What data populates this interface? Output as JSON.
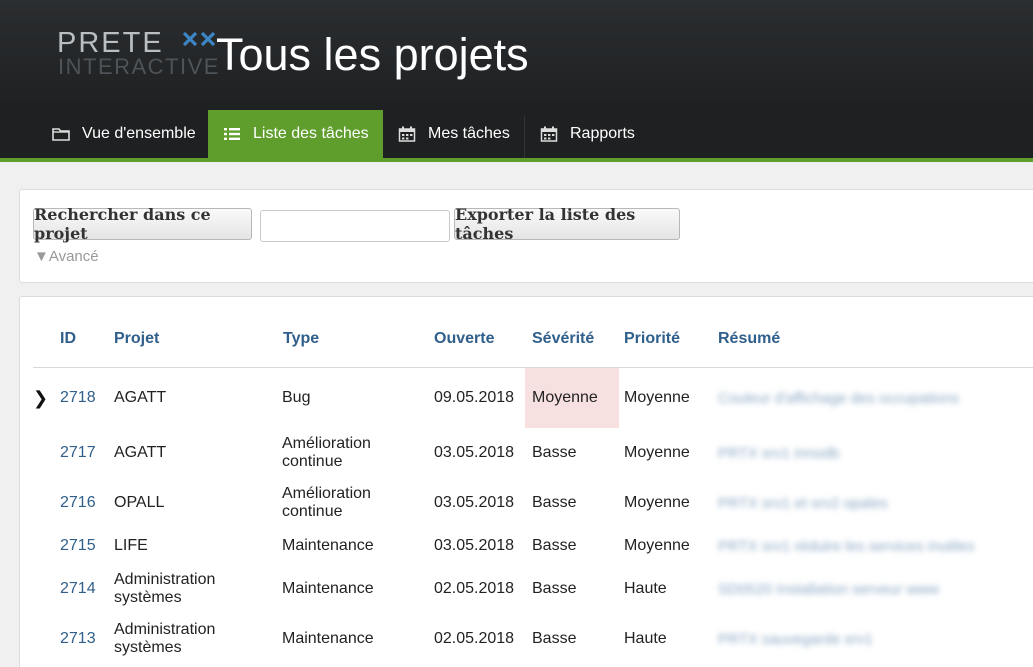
{
  "header": {
    "logo_line1": "PRETE",
    "logo_line2": "INTERACTIVE",
    "logo_mark": "xx",
    "title": "Tous les projets"
  },
  "nav": {
    "tabs": [
      {
        "label": "Vue d'ensemble",
        "icon": "folder-icon",
        "active": false
      },
      {
        "label": "Liste des tâches",
        "icon": "list-icon",
        "active": true
      },
      {
        "label": "Mes tâches",
        "icon": "calendar-icon",
        "active": false
      },
      {
        "label": "Rapports",
        "icon": "calendar-icon",
        "active": false
      }
    ],
    "active_color": "#5f9e2d"
  },
  "search": {
    "button_label": "Rechercher dans ce projet",
    "input_value": "",
    "export_label": "Exporter la liste des tâches",
    "advanced_label": "▼Avancé"
  },
  "table": {
    "columns": [
      "ID",
      "Projet",
      "Type",
      "Ouverte",
      "Sévérité",
      "Priorité",
      "Résumé"
    ],
    "rows": [
      {
        "id": "2718",
        "projet": "AGATT",
        "type": "Bug",
        "ouverte": "09.05.2018",
        "severite": "Moyenne",
        "priorite": "Moyenne",
        "resume": "Couleur d'affichage des occupations",
        "selected": true
      },
      {
        "id": "2717",
        "projet": "AGATT",
        "type": "Amélioration continue",
        "ouverte": "03.05.2018",
        "severite": "Basse",
        "priorite": "Moyenne",
        "resume": "PRTX srv1 innodb"
      },
      {
        "id": "2716",
        "projet": "OPALL",
        "type": "Amélioration continue",
        "ouverte": "03.05.2018",
        "severite": "Basse",
        "priorite": "Moyenne",
        "resume": "PRTX srv1 et srv2 opales"
      },
      {
        "id": "2715",
        "projet": "LIFE",
        "type": "Maintenance",
        "ouverte": "03.05.2018",
        "severite": "Basse",
        "priorite": "Moyenne",
        "resume": "PRTX srv1 réduire les services inutiles"
      },
      {
        "id": "2714",
        "projet": "Administration systèmes",
        "type": "Maintenance",
        "ouverte": "02.05.2018",
        "severite": "Basse",
        "priorite": "Haute",
        "resume": "SD0520 Installation serveur www"
      },
      {
        "id": "2713",
        "projet": "Administration systèmes",
        "type": "Maintenance",
        "ouverte": "02.05.2018",
        "severite": "Basse",
        "priorite": "Haute",
        "resume": "PRTX sauvegarde srv1"
      }
    ]
  }
}
